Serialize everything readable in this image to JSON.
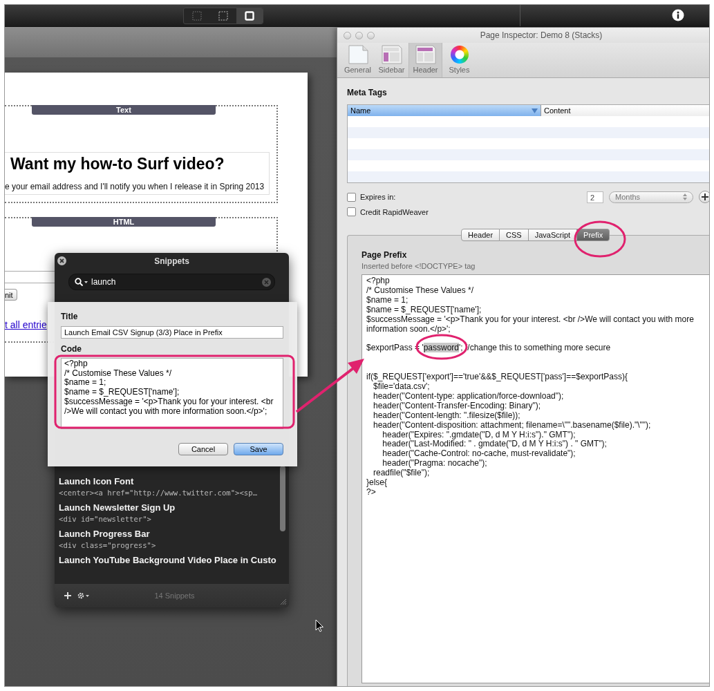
{
  "toolbar": {
    "view_modes": [
      {
        "kind": "dotted-square",
        "selected": false
      },
      {
        "kind": "dotted-corners",
        "selected": false
      },
      {
        "kind": "solid-square",
        "selected": true
      }
    ]
  },
  "canvas": {
    "text_stack_label": "Text",
    "heading": "Want my how-to Surf video?",
    "subtext": "e your email address and I'll notify you when I release it in Spring 2013",
    "html_stack_label": "HTML",
    "submit_button": "nit",
    "link": "t all entrie"
  },
  "inspector": {
    "title": "Page Inspector: Demo 8 (Stacks)",
    "tabs": [
      {
        "label": "General",
        "kind": "document",
        "selected": false
      },
      {
        "label": "Sidebar",
        "kind": "sidebar",
        "selected": false
      },
      {
        "label": "Header",
        "kind": "header",
        "selected": true
      },
      {
        "label": "Styles",
        "kind": "colors",
        "selected": false
      }
    ],
    "meta_tags": {
      "title": "Meta Tags",
      "columns": [
        "Name",
        "Content"
      ]
    },
    "expires": {
      "label": "Expires in:",
      "checked": false,
      "value": "2",
      "unit": "Months"
    },
    "credit": {
      "label": "Credit RapidWeaver",
      "checked": false
    },
    "code_tabs": [
      {
        "label": "Header",
        "selected": false
      },
      {
        "label": "CSS",
        "selected": false
      },
      {
        "label": "JavaScript",
        "selected": false
      },
      {
        "label": "Prefix",
        "selected": true
      }
    ],
    "section_title": "Page Prefix",
    "section_hint": "Inserted before <!DOCTYPE> tag",
    "code": [
      {
        "text": "<?php\n/* Customise These Values */\n$name = 1;\n$name = $_REQUEST['name'];\n$successMessage = '<p>Thank you for your interest. <br />We will contact you with more information soon.</p>';\n\n$exportPass = '",
        "selected": false
      },
      {
        "text": "password",
        "selected": true
      },
      {
        "text": "'; //change this to something more secure\n\n\nif($_REQUEST['export']=='true'&&$_REQUEST['pass']==$exportPass){\n   $file='data.csv';\n   header(\"Content-type: application/force-download\");\n   header(\"Content-Transfer-Encoding: Binary\");\n   header(\"Content-length: \".filesize($file));\n   header(\"Content-disposition: attachment; filename=\\\"\".basename($file).\"\\\"\");\n       header(\"Expires: \".gmdate(\"D, d M Y H:i:s\").\" GMT\");\n       header(\"Last-Modified: \" . gmdate(\"D, d M Y H:i:s\") . \" GMT\");\n       header(\"Cache-Control: no-cache, must-revalidate\");\n       header(\"Pragma: nocache\");\n   readfile(\"$file\");\n}else{\n?>",
        "selected": false
      }
    ]
  },
  "snippets": {
    "title": "Snippets",
    "search": "launch",
    "items": [
      {
        "name": "Launch Icon Font",
        "code": "<center><a href=\"http://www.twitter.com\"><sp…"
      },
      {
        "name": "Launch Newsletter Sign Up",
        "code": "<div id=\"newsletter\">"
      },
      {
        "name": "Launch Progress Bar",
        "code": "<div class=\"progress\">"
      },
      {
        "name": "Launch YouTube Background Video Place in Custo"
      }
    ],
    "count": "14 Snippets"
  },
  "edit_sheet": {
    "title_label": "Title",
    "title_value": "Launch Email CSV Signup (3/3) Place in Prefix",
    "code_label": "Code",
    "code_value": "<?php\n/* Customise These Values */\n$name = 1;\n$name = $_REQUEST['name'];\n$successMessage = '<p>Thank you for your interest. <br />We will contact you with more information soon.</p>';",
    "buttons": [
      {
        "label": "Cancel",
        "kind": "normal"
      },
      {
        "label": "Save",
        "kind": "default"
      }
    ]
  }
}
